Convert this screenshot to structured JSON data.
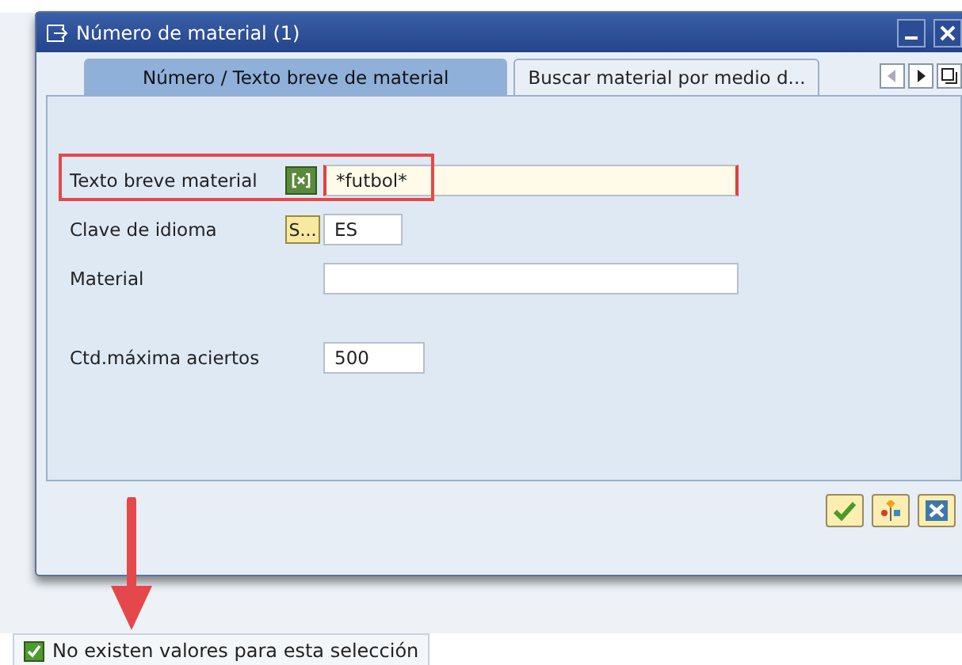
{
  "window": {
    "title": "Número de material (1)"
  },
  "tabs": [
    {
      "label": "Número / Texto breve de material",
      "selected": true
    },
    {
      "label": "Buscar material por medio d...",
      "selected": false
    }
  ],
  "fields": [
    {
      "label": "Texto breve material",
      "button": {
        "kind": "multi"
      },
      "value": "*futbol*",
      "required": true,
      "highlighted": true
    },
    {
      "label": "Clave de idioma",
      "button": {
        "kind": "text",
        "text": "S..."
      },
      "value": "ES",
      "required": false,
      "highlighted": false
    },
    {
      "label": "Material",
      "required": false,
      "highlighted": false
    },
    {
      "label": "Ctd.máxima aciertos",
      "value": "500",
      "required": false,
      "highlighted": false
    }
  ],
  "status_bar": {
    "kind": "success",
    "message": "No existen valores para esta selección"
  }
}
